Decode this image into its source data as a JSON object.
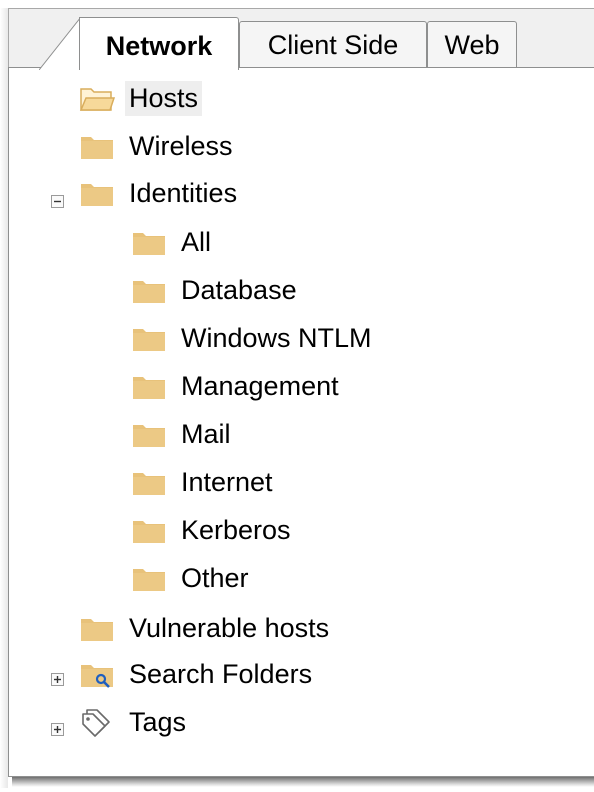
{
  "tabs": [
    {
      "label": "Network",
      "active": true
    },
    {
      "label": "Client Side",
      "active": false
    },
    {
      "label": "Web",
      "active": false
    }
  ],
  "tree": {
    "hosts": {
      "label": "Hosts",
      "icon": "folder-open-icon",
      "selected": true
    },
    "wireless": {
      "label": "Wireless",
      "icon": "folder-icon"
    },
    "identities": {
      "label": "Identities",
      "icon": "folder-icon",
      "expanded": true,
      "children": [
        {
          "label": "All",
          "icon": "folder-icon"
        },
        {
          "label": "Database",
          "icon": "folder-icon"
        },
        {
          "label": "Windows NTLM",
          "icon": "folder-icon"
        },
        {
          "label": "Management",
          "icon": "folder-icon"
        },
        {
          "label": "Mail",
          "icon": "folder-icon"
        },
        {
          "label": "Internet",
          "icon": "folder-icon"
        },
        {
          "label": "Kerberos",
          "icon": "folder-icon"
        },
        {
          "label": "Other",
          "icon": "folder-icon"
        }
      ]
    },
    "vulnerable_hosts": {
      "label": "Vulnerable hosts",
      "icon": "folder-icon"
    },
    "search_folders": {
      "label": "Search Folders",
      "icon": "search-folder-icon",
      "expanded": false
    },
    "tags": {
      "label": "Tags",
      "icon": "tags-icon",
      "expanded": false
    }
  },
  "colors": {
    "folder": "#e8c27a",
    "folder_dark": "#d9ad5c",
    "search_accent": "#1f5fbf"
  }
}
